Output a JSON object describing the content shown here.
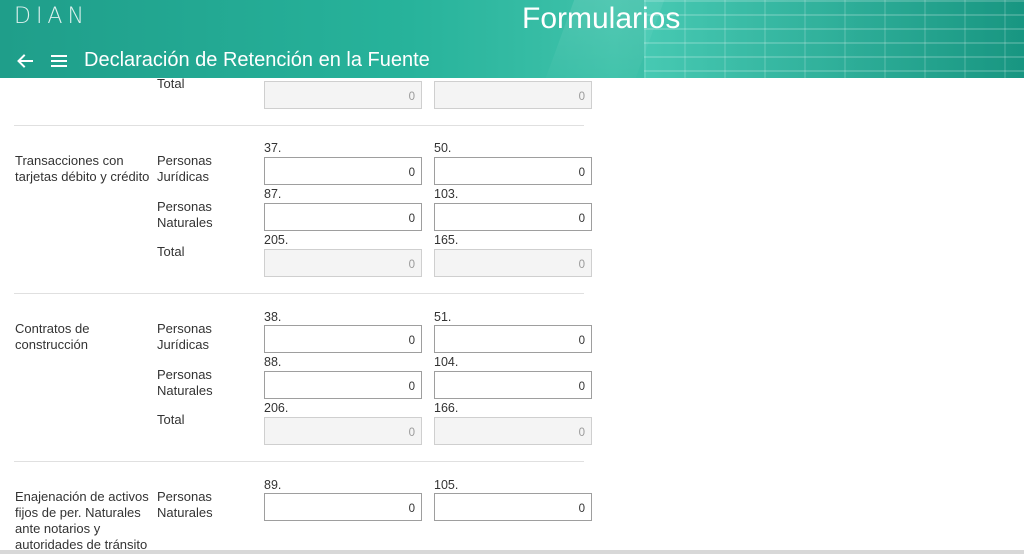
{
  "header": {
    "logo": "DIAN",
    "title": "Formularios",
    "subtitle": "Declaración de Retención en la Fuente",
    "back_icon": "arrow-left-icon",
    "menu_icon": "hamburger-menu-icon"
  },
  "prev_section": {
    "total_label": "Total",
    "total_values": [
      "0",
      "0"
    ]
  },
  "sections": [
    {
      "label": "Transacciones con tarjetas débito y crédito",
      "rows": [
        {
          "label": "Personas Jurídicas",
          "fields": [
            {
              "num": "37.",
              "value": "0"
            },
            {
              "num": "50.",
              "value": "0"
            }
          ]
        },
        {
          "label": "Personas Naturales",
          "fields": [
            {
              "num": "87.",
              "value": "0"
            },
            {
              "num": "103.",
              "value": "0"
            }
          ]
        },
        {
          "label": "Total",
          "fields": [
            {
              "num": "205.",
              "value": "0"
            },
            {
              "num": "165.",
              "value": "0"
            }
          ]
        }
      ]
    },
    {
      "label": "Contratos de construcción",
      "rows": [
        {
          "label": "Personas Jurídicas",
          "fields": [
            {
              "num": "38.",
              "value": "0"
            },
            {
              "num": "51.",
              "value": "0"
            }
          ]
        },
        {
          "label": "Personas Naturales",
          "fields": [
            {
              "num": "88.",
              "value": "0"
            },
            {
              "num": "104.",
              "value": "0"
            }
          ]
        },
        {
          "label": "Total",
          "fields": [
            {
              "num": "206.",
              "value": "0"
            },
            {
              "num": "166.",
              "value": "0"
            }
          ]
        }
      ]
    },
    {
      "label": "Enajenación de activos fijos de per. Naturales ante notarios y autoridades de tránsito",
      "rows": [
        {
          "label": "Personas Naturales",
          "fields": [
            {
              "num": "89.",
              "value": "0"
            },
            {
              "num": "105.",
              "value": "0"
            }
          ]
        }
      ]
    }
  ],
  "colors": {
    "header_teal": "#27b39b",
    "field_border": "#9e9e9e",
    "readonly_bg": "#f4f4f4"
  }
}
